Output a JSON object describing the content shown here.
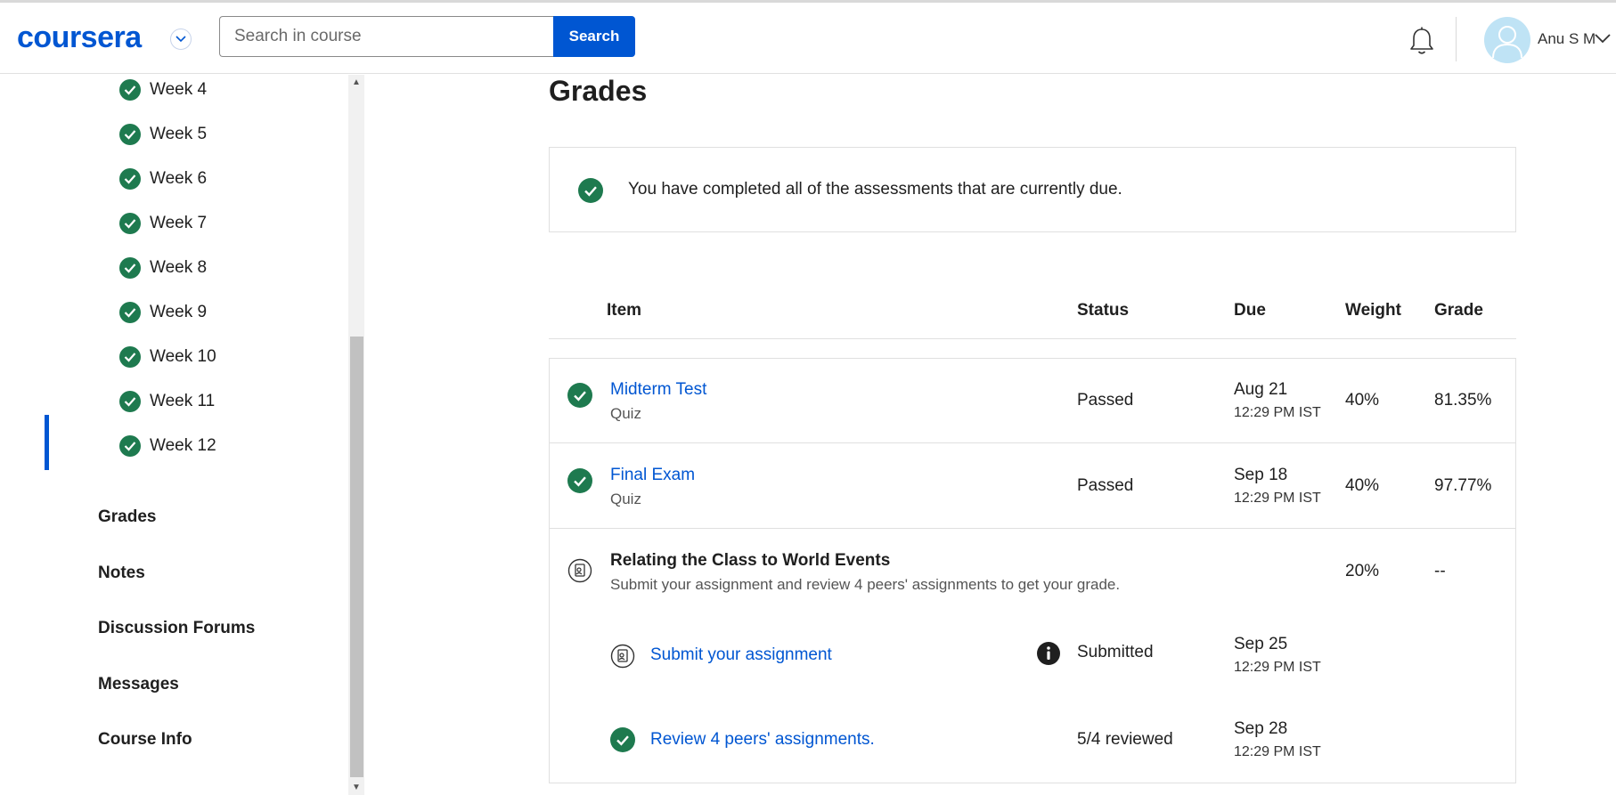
{
  "header": {
    "logo": "coursera",
    "search": {
      "placeholder": "Search in course",
      "button": "Search"
    },
    "user": {
      "name": "Anu S M"
    }
  },
  "sidebar": {
    "weeks": [
      "Week 4",
      "Week 5",
      "Week 6",
      "Week 7",
      "Week 8",
      "Week 9",
      "Week 10",
      "Week 11",
      "Week 12"
    ],
    "nav": [
      "Grades",
      "Notes",
      "Discussion Forums",
      "Messages",
      "Course Info"
    ],
    "active": "Grades"
  },
  "main": {
    "title": "Grades",
    "notice": "You have completed all of the assessments that are currently due.",
    "columns": {
      "item": "Item",
      "status": "Status",
      "due": "Due",
      "weight": "Weight",
      "grade": "Grade"
    },
    "rows": [
      {
        "title": "Midterm Test",
        "type": "Quiz",
        "status": "Passed",
        "due_date": "Aug 21",
        "due_time": "12:29 PM IST",
        "weight": "40%",
        "grade": "81.35%"
      },
      {
        "title": "Final Exam",
        "type": "Quiz",
        "status": "Passed",
        "due_date": "Sep 18",
        "due_time": "12:29 PM IST",
        "weight": "40%",
        "grade": "97.77%"
      }
    ],
    "peer": {
      "title": "Relating the Class to World Events",
      "description": "Submit your assignment and review 4 peers' assignments to get your grade.",
      "weight": "20%",
      "grade": "--",
      "subitems": [
        {
          "title": "Submit your assignment",
          "status": "Submitted",
          "due_date": "Sep 25",
          "due_time": "12:29 PM IST"
        },
        {
          "title": "Review 4 peers' assignments.",
          "status": "5/4 reviewed",
          "due_date": "Sep 28",
          "due_time": "12:29 PM IST"
        }
      ]
    }
  },
  "colors": {
    "brand": "#0056d2",
    "success": "#1e7a4f"
  }
}
